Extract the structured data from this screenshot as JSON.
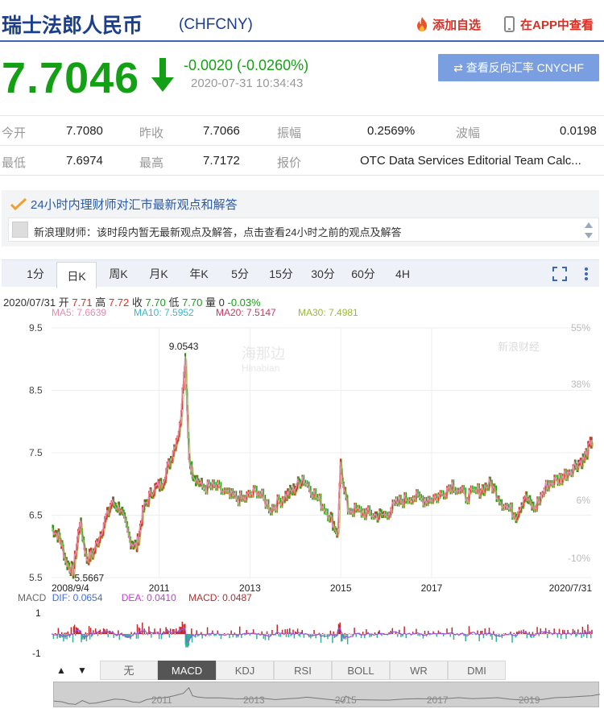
{
  "header": {
    "title": "瑞士法郎人民币",
    "code": "(CHFCNY)",
    "add_fav": "添加自选",
    "view_app": "在APP中查看"
  },
  "quote": {
    "price": "7.7046",
    "change": "-0.0020 (-0.0260%)",
    "time": "2020-07-31 10:34:43",
    "reverse_btn": "⇄ 查看反向汇率 CNYCHF"
  },
  "stats": {
    "open_label": "今开",
    "open": "7.7080",
    "prev_label": "昨收",
    "prev": "7.7066",
    "amp_label": "振幅",
    "amp": "0.2569%",
    "wave_label": "波幅",
    "wave": "0.0198",
    "low_label": "最低",
    "low": "7.6974",
    "high_label": "最高",
    "high": "7.7172",
    "quote_label": "报价",
    "quote_src": "OTC Data Services Editorial Team Calc..."
  },
  "news": {
    "title": "24小时内理财师对汇市最新观点和解答",
    "text": "新浪理财师：该时段内暂无最新观点及解答，点击查看24小时之前的观点及解答"
  },
  "tabs": [
    "1分",
    "日K",
    "周K",
    "月K",
    "年K",
    "5分",
    "15分",
    "30分",
    "60分",
    "4H"
  ],
  "ohlc": {
    "date": "2020/07/31",
    "open_l": "开",
    "open": "7.71",
    "high_l": "高",
    "high": "7.72",
    "close_l": "收",
    "close": "7.70",
    "low_l": "低",
    "low": "7.70",
    "vol_l": "量",
    "vol": "0",
    "pct": "-0.03%"
  },
  "ma": {
    "ma5": "MA5: 7.6639",
    "ma10": "MA10: 7.5952",
    "ma20": "MA20: 7.5147",
    "ma30": "MA30: 7.4981"
  },
  "macd": {
    "label": "MACD",
    "dif": "DIF: 0.0654",
    "dea": "DEA: 0.0410",
    "macd": "MACD: 0.0487"
  },
  "indicators": [
    "无",
    "MACD",
    "KDJ",
    "RSI",
    "BOLL",
    "WR",
    "DMI"
  ],
  "watermark": {
    "hinabian_cn": "海那边",
    "hinabian_en": "Hinabian",
    "sina": "新浪财经"
  },
  "colors": {
    "up": "#d93025",
    "down": "#14a014",
    "brand": "#1a3f8f",
    "button": "#7a9fe0"
  },
  "chart_data": {
    "type": "line",
    "x_start": "2008/9/4",
    "x_end": "2020/7/31",
    "x_ticks": [
      "2011",
      "2013",
      "2015",
      "2017"
    ],
    "y_ticks": [
      "9.5",
      "8.5",
      "7.5",
      "6.5",
      "5.5"
    ],
    "y_range": [
      5.5,
      9.5
    ],
    "pct_ticks": [
      "55%",
      "38%",
      "6%",
      "-10%"
    ],
    "annotations": {
      "max": "9.0543",
      "min": "5.5667"
    },
    "macd_ticks": [
      "1",
      "-1"
    ],
    "overview_ticks": [
      "2011",
      "2013",
      "2015",
      "2017",
      "2019"
    ],
    "series": [
      {
        "values": [
          [
            2008.68,
            6.3
          ],
          [
            2008.85,
            6.15
          ],
          [
            2009.0,
            5.75
          ],
          [
            2009.15,
            5.6
          ],
          [
            2009.3,
            6.4
          ],
          [
            2009.45,
            5.8
          ],
          [
            2009.6,
            5.9
          ],
          [
            2009.8,
            6.3
          ],
          [
            2010.0,
            6.7
          ],
          [
            2010.2,
            6.6
          ],
          [
            2010.4,
            6.1
          ],
          [
            2010.55,
            6.0
          ],
          [
            2010.7,
            6.6
          ],
          [
            2010.9,
            6.9
          ],
          [
            2011.1,
            7.0
          ],
          [
            2011.3,
            7.4
          ],
          [
            2011.5,
            7.9
          ],
          [
            2011.62,
            9.05
          ],
          [
            2011.7,
            7.4
          ],
          [
            2011.8,
            7.15
          ],
          [
            2012.0,
            6.95
          ],
          [
            2012.3,
            6.95
          ],
          [
            2012.6,
            6.8
          ],
          [
            2012.9,
            6.75
          ],
          [
            2013.2,
            6.9
          ],
          [
            2013.5,
            6.6
          ],
          [
            2013.8,
            6.8
          ],
          [
            2014.0,
            6.9
          ],
          [
            2014.2,
            7.1
          ],
          [
            2014.5,
            6.8
          ],
          [
            2014.8,
            6.5
          ],
          [
            2014.98,
            6.2
          ],
          [
            2015.04,
            7.3
          ],
          [
            2015.2,
            6.6
          ],
          [
            2015.5,
            6.55
          ],
          [
            2015.8,
            6.5
          ],
          [
            2016.0,
            6.5
          ],
          [
            2016.3,
            6.7
          ],
          [
            2016.6,
            6.8
          ],
          [
            2016.9,
            6.75
          ],
          [
            2017.2,
            6.8
          ],
          [
            2017.5,
            7.0
          ],
          [
            2017.8,
            6.8
          ],
          [
            2018.1,
            6.9
          ],
          [
            2018.35,
            7.0
          ],
          [
            2018.6,
            6.7
          ],
          [
            2018.9,
            6.5
          ],
          [
            2019.1,
            6.8
          ],
          [
            2019.3,
            6.6
          ],
          [
            2019.6,
            7.0
          ],
          [
            2019.9,
            7.1
          ],
          [
            2020.2,
            7.3
          ],
          [
            2020.4,
            7.4
          ],
          [
            2020.58,
            7.7046
          ]
        ]
      }
    ]
  }
}
